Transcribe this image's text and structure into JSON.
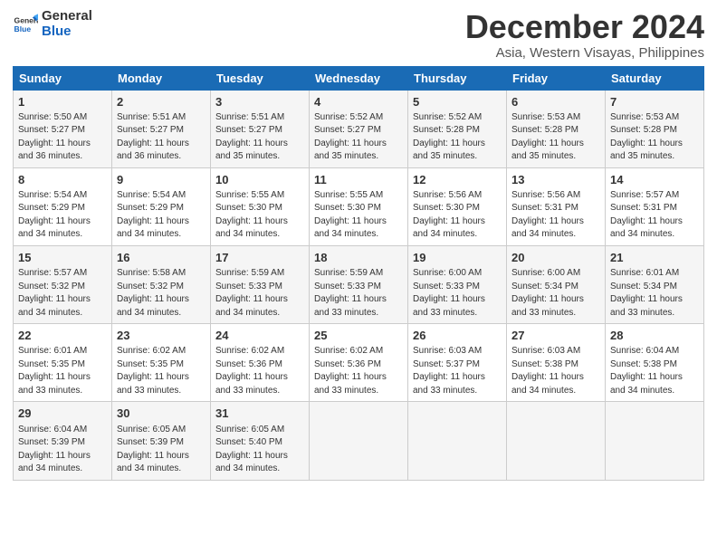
{
  "logo": {
    "line1": "General",
    "line2": "Blue"
  },
  "title": "December 2024",
  "subtitle": "Asia, Western Visayas, Philippines",
  "days_header": [
    "Sunday",
    "Monday",
    "Tuesday",
    "Wednesday",
    "Thursday",
    "Friday",
    "Saturday"
  ],
  "weeks": [
    [
      {
        "day": "1",
        "rise": "5:50 AM",
        "set": "5:27 PM",
        "hours": "11 hours and 36 minutes."
      },
      {
        "day": "2",
        "rise": "5:51 AM",
        "set": "5:27 PM",
        "hours": "11 hours and 36 minutes."
      },
      {
        "day": "3",
        "rise": "5:51 AM",
        "set": "5:27 PM",
        "hours": "11 hours and 35 minutes."
      },
      {
        "day": "4",
        "rise": "5:52 AM",
        "set": "5:27 PM",
        "hours": "11 hours and 35 minutes."
      },
      {
        "day": "5",
        "rise": "5:52 AM",
        "set": "5:28 PM",
        "hours": "11 hours and 35 minutes."
      },
      {
        "day": "6",
        "rise": "5:53 AM",
        "set": "5:28 PM",
        "hours": "11 hours and 35 minutes."
      },
      {
        "day": "7",
        "rise": "5:53 AM",
        "set": "5:28 PM",
        "hours": "11 hours and 35 minutes."
      }
    ],
    [
      {
        "day": "8",
        "rise": "5:54 AM",
        "set": "5:29 PM",
        "hours": "11 hours and 34 minutes."
      },
      {
        "day": "9",
        "rise": "5:54 AM",
        "set": "5:29 PM",
        "hours": "11 hours and 34 minutes."
      },
      {
        "day": "10",
        "rise": "5:55 AM",
        "set": "5:30 PM",
        "hours": "11 hours and 34 minutes."
      },
      {
        "day": "11",
        "rise": "5:55 AM",
        "set": "5:30 PM",
        "hours": "11 hours and 34 minutes."
      },
      {
        "day": "12",
        "rise": "5:56 AM",
        "set": "5:30 PM",
        "hours": "11 hours and 34 minutes."
      },
      {
        "day": "13",
        "rise": "5:56 AM",
        "set": "5:31 PM",
        "hours": "11 hours and 34 minutes."
      },
      {
        "day": "14",
        "rise": "5:57 AM",
        "set": "5:31 PM",
        "hours": "11 hours and 34 minutes."
      }
    ],
    [
      {
        "day": "15",
        "rise": "5:57 AM",
        "set": "5:32 PM",
        "hours": "11 hours and 34 minutes."
      },
      {
        "day": "16",
        "rise": "5:58 AM",
        "set": "5:32 PM",
        "hours": "11 hours and 34 minutes."
      },
      {
        "day": "17",
        "rise": "5:59 AM",
        "set": "5:33 PM",
        "hours": "11 hours and 34 minutes."
      },
      {
        "day": "18",
        "rise": "5:59 AM",
        "set": "5:33 PM",
        "hours": "11 hours and 33 minutes."
      },
      {
        "day": "19",
        "rise": "6:00 AM",
        "set": "5:33 PM",
        "hours": "11 hours and 33 minutes."
      },
      {
        "day": "20",
        "rise": "6:00 AM",
        "set": "5:34 PM",
        "hours": "11 hours and 33 minutes."
      },
      {
        "day": "21",
        "rise": "6:01 AM",
        "set": "5:34 PM",
        "hours": "11 hours and 33 minutes."
      }
    ],
    [
      {
        "day": "22",
        "rise": "6:01 AM",
        "set": "5:35 PM",
        "hours": "11 hours and 33 minutes."
      },
      {
        "day": "23",
        "rise": "6:02 AM",
        "set": "5:35 PM",
        "hours": "11 hours and 33 minutes."
      },
      {
        "day": "24",
        "rise": "6:02 AM",
        "set": "5:36 PM",
        "hours": "11 hours and 33 minutes."
      },
      {
        "day": "25",
        "rise": "6:02 AM",
        "set": "5:36 PM",
        "hours": "11 hours and 33 minutes."
      },
      {
        "day": "26",
        "rise": "6:03 AM",
        "set": "5:37 PM",
        "hours": "11 hours and 33 minutes."
      },
      {
        "day": "27",
        "rise": "6:03 AM",
        "set": "5:38 PM",
        "hours": "11 hours and 34 minutes."
      },
      {
        "day": "28",
        "rise": "6:04 AM",
        "set": "5:38 PM",
        "hours": "11 hours and 34 minutes."
      }
    ],
    [
      {
        "day": "29",
        "rise": "6:04 AM",
        "set": "5:39 PM",
        "hours": "11 hours and 34 minutes."
      },
      {
        "day": "30",
        "rise": "6:05 AM",
        "set": "5:39 PM",
        "hours": "11 hours and 34 minutes."
      },
      {
        "day": "31",
        "rise": "6:05 AM",
        "set": "5:40 PM",
        "hours": "11 hours and 34 minutes."
      },
      null,
      null,
      null,
      null
    ]
  ],
  "daylight_label": "Daylight:",
  "sunrise_label": "Sunrise:",
  "sunset_label": "Sunset:"
}
